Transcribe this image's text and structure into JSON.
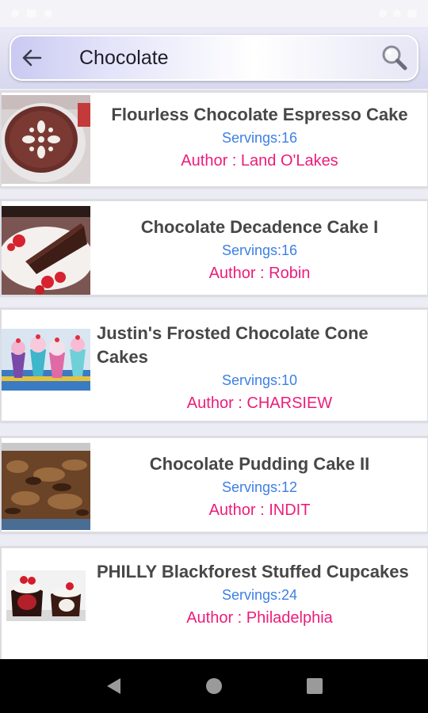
{
  "search": {
    "query": "Chocolate"
  },
  "recipes": [
    {
      "title": "Flourless Chocolate Espresso Cake",
      "servings": "Servings:16",
      "author": "Author : Land O'Lakes"
    },
    {
      "title": "Chocolate Decadence Cake I",
      "servings": "Servings:16",
      "author": "Author : Robin"
    },
    {
      "title": "Justin's Frosted Chocolate Cone Cakes",
      "servings": "Servings:10",
      "author": "Author : CHARSIEW"
    },
    {
      "title": "Chocolate Pudding Cake II",
      "servings": "Servings:12",
      "author": "Author : INDIT"
    },
    {
      "title": "PHILLY Blackforest Stuffed Cupcakes",
      "servings": "Servings:24",
      "author": "Author : Philadelphia"
    }
  ],
  "colors": {
    "servings": "#3d7fe3",
    "author": "#ec1d7a",
    "title": "#474747"
  },
  "icons": {
    "back": "arrow-left-icon",
    "search": "magnifier-icon",
    "nav_back": "triangle-back-icon",
    "nav_home": "circle-home-icon",
    "nav_recents": "square-recents-icon"
  }
}
